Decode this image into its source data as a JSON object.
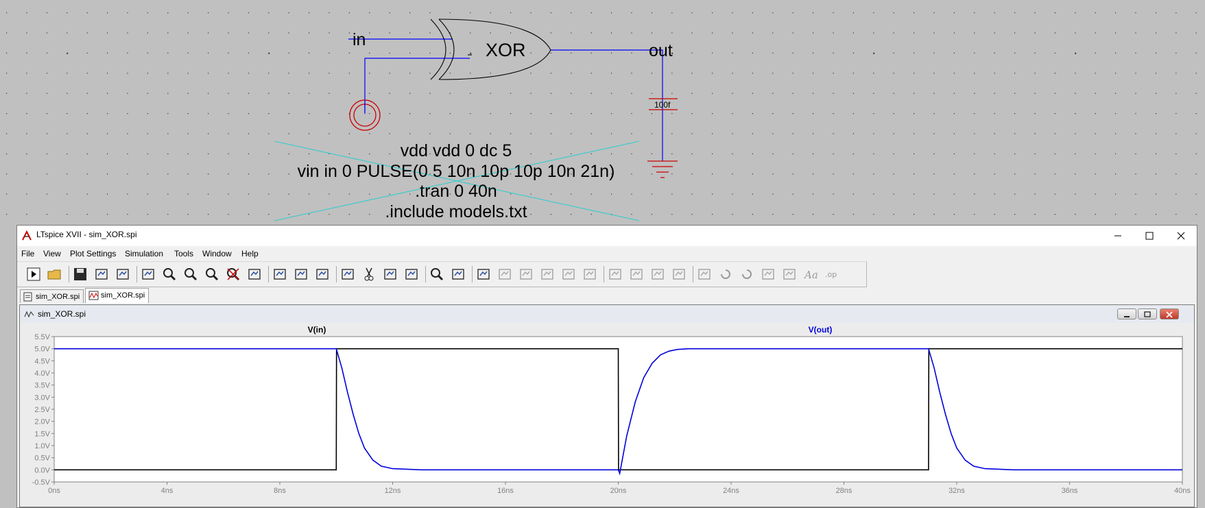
{
  "schematic": {
    "net_in": "in",
    "net_out": "out",
    "gate_label": "XOR",
    "cap_value": "100f",
    "directives": [
      "vdd vdd 0 dc 5",
      "vin in 0 PULSE(0 5 10n 10p 10p 10n 21n)",
      ".tran 0 40n",
      ".include models.txt"
    ]
  },
  "window": {
    "title": "LTspice XVII - sim_XOR.spi",
    "controls": {
      "minimize": "─",
      "maximize": "☐",
      "close": "✕"
    }
  },
  "menu": [
    "File",
    "View",
    "Plot Settings",
    "Simulation",
    "Tools",
    "Window",
    "Help"
  ],
  "toolbar_icons": [
    "run-icon",
    "open-icon",
    "save-icon",
    "control-panel-icon",
    "halt-icon",
    "pan-icon",
    "zoom-in-icon",
    "zoom-area-icon",
    "zoom-out-icon",
    "zoom-fit-icon",
    "autorange-icon",
    "measure-icon",
    "tile-horizontal-icon",
    "tile-vertical-icon",
    "cascade-icon",
    "cut-icon",
    "copy-icon",
    "paste-icon",
    "find-icon",
    "print-icon",
    "print-preview-icon",
    "wire-icon",
    "ground-icon",
    "label-icon",
    "resistor-icon",
    "capacitor-icon",
    "inductor-icon",
    "diode-icon",
    "component-icon",
    "move-icon",
    "drag-icon",
    "undo-icon",
    "redo-icon",
    "rotate-icon",
    "mirror-icon",
    "text-icon",
    "spice-directive-icon"
  ],
  "tabs": [
    {
      "label": "sim_XOR.spi",
      "icon": "schematic-icon"
    },
    {
      "label": "sim_XOR.spi",
      "icon": "waveform-icon"
    }
  ],
  "plot_window_title": "sim_XOR.spi",
  "colors": {
    "vin": "#000000",
    "vout": "#0000dd",
    "wire": "#0000ff",
    "gnd": "#ff0000",
    "directive_cross": "#33cccc"
  },
  "chart_data": {
    "type": "line",
    "title": "",
    "xlabel": "",
    "ylabel": "",
    "xlim": [
      0,
      40
    ],
    "ylim": [
      -0.5,
      5.5
    ],
    "x_unit": "ns",
    "y_unit": "V",
    "x_ticks": [
      "0ns",
      "4ns",
      "8ns",
      "12ns",
      "16ns",
      "20ns",
      "24ns",
      "28ns",
      "32ns",
      "36ns",
      "40ns"
    ],
    "y_ticks": [
      "5.5V",
      "5.0V",
      "4.5V",
      "4.0V",
      "3.5V",
      "3.0V",
      "2.5V",
      "2.0V",
      "1.5V",
      "1.0V",
      "0.5V",
      "0.0V",
      "-0.5V"
    ],
    "grid": false,
    "series": [
      {
        "name": "V(in)",
        "x": [
          0,
          10,
          10.01,
          20,
          20.01,
          31,
          31.01,
          40
        ],
        "y": [
          0,
          0,
          5,
          5,
          0,
          0,
          5,
          5
        ]
      },
      {
        "name": "V(out)",
        "x": [
          0,
          10,
          10.2,
          10.4,
          10.6,
          10.8,
          11.0,
          11.3,
          11.6,
          12.0,
          13,
          20,
          20.05,
          20.3,
          20.6,
          20.9,
          21.2,
          21.5,
          21.8,
          22.1,
          22.5,
          23,
          31,
          31.2,
          31.4,
          31.6,
          31.8,
          32.0,
          32.3,
          32.6,
          33.0,
          34,
          40
        ],
        "y": [
          5,
          5,
          4.2,
          3.2,
          2.3,
          1.5,
          0.9,
          0.4,
          0.15,
          0.05,
          0,
          0,
          -0.15,
          1.4,
          2.8,
          3.8,
          4.4,
          4.75,
          4.9,
          4.97,
          5,
          5,
          5,
          4.2,
          3.2,
          2.3,
          1.5,
          0.9,
          0.4,
          0.15,
          0.05,
          0,
          0
        ]
      }
    ]
  }
}
